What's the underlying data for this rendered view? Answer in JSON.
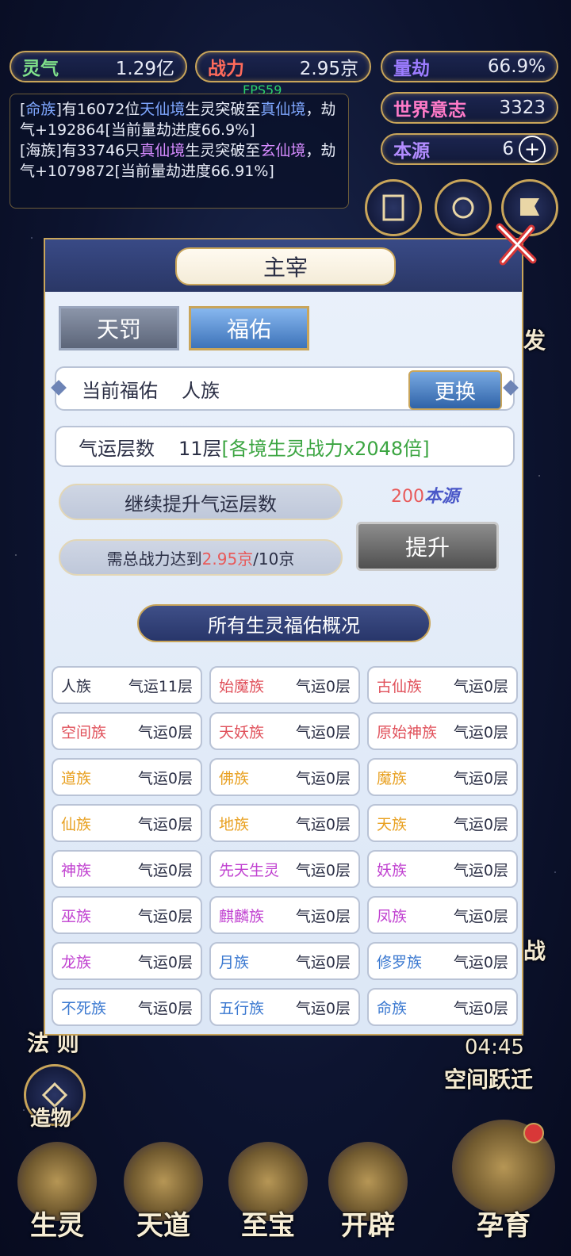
{
  "stats": {
    "lingqi": {
      "label": "灵气",
      "value": "1.29亿",
      "color": "#7fe08a"
    },
    "zhanli": {
      "label": "战力",
      "value": "2.95京",
      "color": "#ff6b5b"
    },
    "liangjie": {
      "label": "量劫",
      "value": "66.9%",
      "color": "#9c7cff"
    },
    "shijie": {
      "label": "世界意志",
      "value": "3323",
      "color": "#ff7bc8"
    },
    "benyuan": {
      "label": "本源",
      "value": "6",
      "color": "#b28cff"
    }
  },
  "fps": "FPS59",
  "log": {
    "line1_a": "[",
    "line1_race": "命族",
    "line1_b": "]有16072位",
    "line1_realm": "天仙境",
    "line1_c": "生灵突破至",
    "line1_target": "真仙境",
    "line1_d": "，劫气+192864[当前量劫进度66.9%]",
    "line2_a": "[海族]有33746只",
    "line2_realm": "真仙境",
    "line2_c": "生灵突破至",
    "line2_target": "玄仙境",
    "line2_d": "，劫气+1079872[当前量劫进度66.91%]"
  },
  "modal": {
    "title": "主宰",
    "tabs": [
      {
        "label": "天罚"
      },
      {
        "label": "福佑"
      }
    ],
    "current_label": "当前福佑",
    "current_value": "人族",
    "change_label": "更换",
    "luck_label": "气运层数",
    "luck_value": "11层",
    "luck_bonus": "[各境生灵战力x2048倍]",
    "continue_label": "继续提升气运层数",
    "cost_value": "200",
    "cost_unit": "本源",
    "req_prefix": "需总战力达到",
    "req_current": "2.95京",
    "req_target": "/10京",
    "upgrade_label": "提升",
    "overview_title": "所有生灵福佑概况",
    "races": [
      {
        "name": "人族",
        "luck": "气运11层",
        "color": "#2b2f45"
      },
      {
        "name": "始魔族",
        "luck": "气运0层",
        "color": "#e0505a"
      },
      {
        "name": "古仙族",
        "luck": "气运0层",
        "color": "#e0505a"
      },
      {
        "name": "空间族",
        "luck": "气运0层",
        "color": "#e0505a"
      },
      {
        "name": "天妖族",
        "luck": "气运0层",
        "color": "#e0505a"
      },
      {
        "name": "原始神族",
        "luck": "气运0层",
        "color": "#e0505a"
      },
      {
        "name": "道族",
        "luck": "气运0层",
        "color": "#e8a020"
      },
      {
        "name": "佛族",
        "luck": "气运0层",
        "color": "#e8a020"
      },
      {
        "name": "魔族",
        "luck": "气运0层",
        "color": "#e8a020"
      },
      {
        "name": "仙族",
        "luck": "气运0层",
        "color": "#e8a020"
      },
      {
        "name": "地族",
        "luck": "气运0层",
        "color": "#e8a020"
      },
      {
        "name": "天族",
        "luck": "气运0层",
        "color": "#e8a020"
      },
      {
        "name": "神族",
        "luck": "气运0层",
        "color": "#c040d0"
      },
      {
        "name": "先天生灵",
        "luck": "气运0层",
        "color": "#c040d0"
      },
      {
        "name": "妖族",
        "luck": "气运0层",
        "color": "#c040d0"
      },
      {
        "name": "巫族",
        "luck": "气运0层",
        "color": "#c040d0"
      },
      {
        "name": "麒麟族",
        "luck": "气运0层",
        "color": "#c040d0"
      },
      {
        "name": "凤族",
        "luck": "气运0层",
        "color": "#c040d0"
      },
      {
        "name": "龙族",
        "luck": "气运0层",
        "color": "#c040d0"
      },
      {
        "name": "月族",
        "luck": "气运0层",
        "color": "#3a78d0"
      },
      {
        "name": "修罗族",
        "luck": "气运0层",
        "color": "#3a78d0"
      },
      {
        "name": "不死族",
        "luck": "气运0层",
        "color": "#3a78d0"
      },
      {
        "name": "五行族",
        "luck": "气运0层",
        "color": "#3a78d0"
      },
      {
        "name": "命族",
        "luck": "气运0层",
        "color": "#3a78d0"
      }
    ]
  },
  "side": {
    "right_partial": "发",
    "right_partial2": "战",
    "timer": "04:45",
    "space_jump": "空间跃迁",
    "law": "法 则",
    "create": "造物"
  },
  "bottom_nav": [
    {
      "label": "生灵"
    },
    {
      "label": "天道"
    },
    {
      "label": "至宝"
    },
    {
      "label": "开辟"
    },
    {
      "label": "孕育"
    }
  ]
}
